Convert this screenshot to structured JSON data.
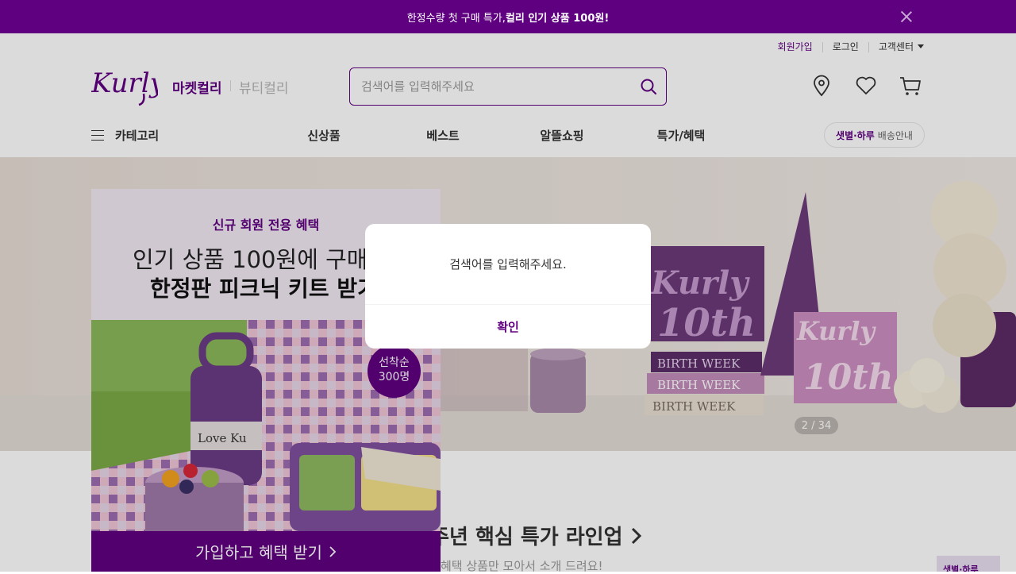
{
  "promo_banner": {
    "text_regular": "한정수량 첫 구매 특가, ",
    "text_bold": "컬리 인기 상품 100원!"
  },
  "user_links": {
    "signup": "회원가입",
    "login": "로그인",
    "customer_center": "고객센터"
  },
  "header": {
    "logo_text": "Kurly",
    "market_tab": "마켓컬리",
    "beauty_tab": "뷰티컬리",
    "search_placeholder": "검색어를 입력해주세요"
  },
  "gnb": {
    "category": "카테고리",
    "items": [
      "신상품",
      "베스트",
      "알뜰쇼핑",
      "특가/혜택"
    ],
    "delivery_bold": "샛별·하루",
    "delivery_text": "배송안내"
  },
  "hero": {
    "counter": "2 / 34",
    "candles": [
      {
        "brand": "Kurly",
        "label": "10th"
      },
      {
        "brand": "Kurly",
        "label": "10th"
      }
    ],
    "books": [
      "BIRTH WEEK",
      "BIRTH WEEK",
      "BIRTH WEEK"
    ]
  },
  "promo_popup": {
    "tag": "신규 회원 전용 혜택",
    "line1": "인기 상품 100원에 구매하",
    "line2": "한정판 피크닉 키트 받기",
    "badge_line1": "선착순",
    "badge_line2": "300명",
    "button": "가입하고 혜택 받기"
  },
  "section": {
    "title": "0주년 핵심 특가 라인업",
    "subtitle": "혜택 상품만 모아서 소개 드려요!",
    "side_banner": "샛별·하루"
  },
  "alert": {
    "message": "검색어를 입력해주세요.",
    "confirm": "확인"
  },
  "colors": {
    "brand": "#5f0080",
    "dim": "rgba(0,0,0,0.14)"
  }
}
